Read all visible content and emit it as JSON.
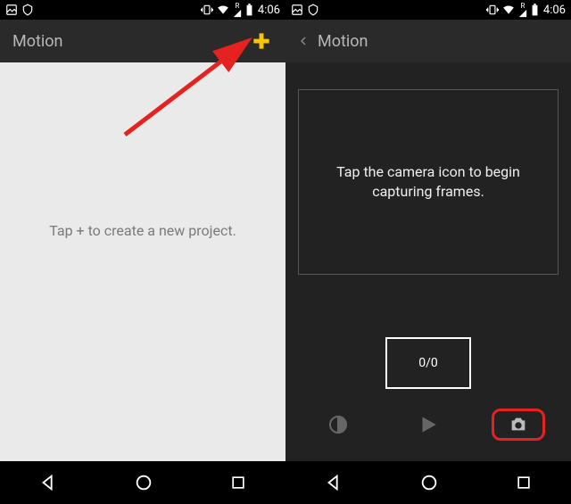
{
  "statusbar": {
    "time": "4:06"
  },
  "left": {
    "title": "Motion",
    "empty_text": "Tap + to create a new project."
  },
  "right": {
    "title": "Motion",
    "preview_text": "Tap the camera icon to begin capturing frames.",
    "frame_counter": "0/0"
  }
}
